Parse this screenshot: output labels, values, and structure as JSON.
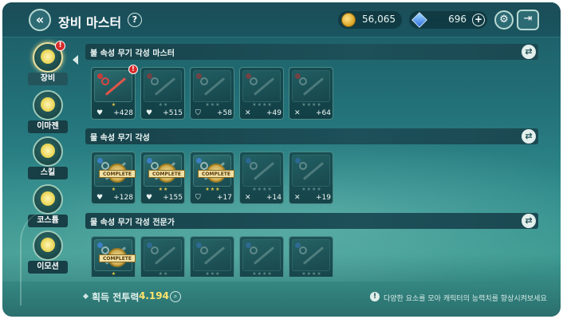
{
  "header": {
    "title": "장비 마스터",
    "help_symbol": "?",
    "back_symbol": "«",
    "gold": "56,065",
    "gems": "696",
    "plus_symbol": "+"
  },
  "sidebar": {
    "items": [
      {
        "label": "장비",
        "active": true,
        "badge": "!"
      },
      {
        "label": "이마젠",
        "active": false
      },
      {
        "label": "스킬",
        "active": false
      },
      {
        "label": "코스튬",
        "active": false
      },
      {
        "label": "이모션",
        "active": false
      }
    ]
  },
  "sections": [
    {
      "title": "불 속성 무기 각성 마스터",
      "cards": [
        {
          "stat_icon": "♥",
          "value": "+428",
          "stars": "★",
          "complete": false,
          "alert": "!"
        },
        {
          "stat_icon": "♥",
          "value": "+515",
          "stars": "★★",
          "complete": false
        },
        {
          "stat_icon": "⛉",
          "value": "+58",
          "stars": "★★★",
          "complete": false
        },
        {
          "stat_icon": "✕",
          "value": "+49",
          "stars": "★★★★",
          "complete": false
        },
        {
          "stat_icon": "✕",
          "value": "+64",
          "stars": "★★★★",
          "complete": false
        }
      ]
    },
    {
      "title": "물 속성 무기 각성",
      "cards": [
        {
          "stat_icon": "♥",
          "value": "+128",
          "stars": "★",
          "complete": true
        },
        {
          "stat_icon": "♥",
          "value": "+155",
          "stars": "★★",
          "complete": true
        },
        {
          "stat_icon": "⛉",
          "value": "+17",
          "stars": "★★★",
          "complete": true
        },
        {
          "stat_icon": "✕",
          "value": "+14",
          "stars": "★★★★",
          "complete": false
        },
        {
          "stat_icon": "✕",
          "value": "+19",
          "stars": "★★★★",
          "complete": false
        }
      ]
    },
    {
      "title": "물 속성 무기 각성 전문가",
      "cards": [
        {
          "stars": "★",
          "complete": true
        },
        {
          "stars": "★★",
          "complete": false
        },
        {
          "stars": "★★★",
          "complete": false
        },
        {
          "stars": "★★★★",
          "complete": false
        },
        {
          "stars": "★★★★",
          "complete": false
        }
      ]
    }
  ],
  "complete_label": "COMPLETE",
  "footer": {
    "combat_power_label": "획득 전투력",
    "combat_power_value": "4.194",
    "tip": "다양한 요소를 모아 캐릭터의 능력치를 향상시켜보세요"
  },
  "colors": {
    "accent_gold": "#ffe46b",
    "alert_red": "#d62a2a",
    "panel_teal": "#1d5059"
  }
}
